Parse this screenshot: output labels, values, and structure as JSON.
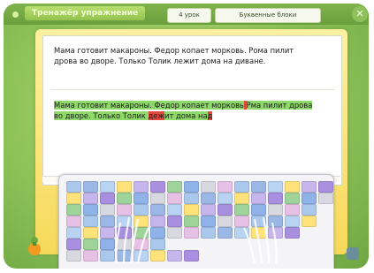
{
  "header": {
    "app_title": "Тренажёр упражнение",
    "tabs": [
      {
        "label": "4 урок"
      },
      {
        "label": "Буквенные блоки"
      }
    ],
    "close_icon": "close-icon"
  },
  "exercise": {
    "sample_text": "Мама готовит макароны. Федор копает морковь. Рома пилит дрова во дворе. Только Толик лежит дома на диване.",
    "typed_segments": [
      {
        "text": "Мама готовит макароны. Федор копает морковь",
        "state": "correct"
      },
      {
        "text": " ",
        "state": "error"
      },
      {
        "text": "Рма пилит дрова во дворе. Только Толик ",
        "state": "correct"
      },
      {
        "text": "деж",
        "state": "error"
      },
      {
        "text": "ит дома на",
        "state": "correct"
      },
      {
        "text": "д",
        "state": "error"
      }
    ]
  },
  "colors": {
    "correct_highlight": "#8fd86a",
    "error_highlight": "#e2483c",
    "accent_green": "#8fc45a",
    "frame_yellow": "#f6d95a"
  },
  "icons": [
    "close-icon",
    "keyboard-icon",
    "hands-icon",
    "mascot-icon",
    "next-icon"
  ]
}
